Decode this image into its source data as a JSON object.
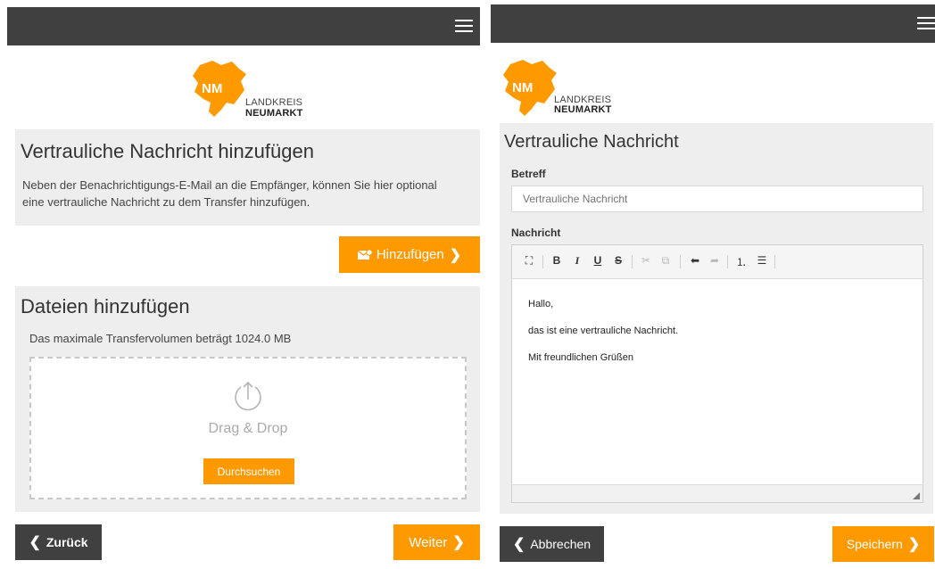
{
  "left": {
    "logo": {
      "abbr": "NM",
      "line1": "LANDKREIS",
      "line2": "NEUMARKT"
    },
    "message_section": {
      "title": "Vertrauliche Nachricht hinzufügen",
      "description_line1": "Neben der Benachrichtigungs-E-Mail an die Empfänger, können Sie hier optional",
      "description_line2": "eine vertrauliche Nachricht zu dem Transfer hinzufügen.",
      "add_button": "Hinzufügen"
    },
    "files_section": {
      "title": "Dateien hinzufügen",
      "limit_text": "Das maximale Transfervolumen beträgt 1024.0 MB",
      "drop_label": "Drag & Drop",
      "browse_button": "Durchsuchen"
    },
    "back_button": "Zurück",
    "next_button": "Weiter"
  },
  "right": {
    "logo": {
      "abbr": "NM",
      "line1": "LANDKREIS",
      "line2": "NEUMARKT"
    },
    "title": "Vertrauliche Nachricht",
    "subject_label": "Betreff",
    "subject_placeholder": "Vertrauliche Nachricht",
    "message_label": "Nachricht",
    "toolbar": [
      "maximize-icon",
      "bold-icon",
      "italic-icon",
      "underline-icon",
      "strikethrough-icon",
      "cut-icon",
      "copy-icon",
      "undo-icon",
      "redo-icon",
      "numbered-list-icon",
      "bullet-list-icon"
    ],
    "message_lines": [
      "Hallo,",
      "das ist eine vertrauliche Nachricht.",
      "Mit freundlichen Grüßen"
    ],
    "cancel_button": "Abbrechen",
    "save_button": "Speichern"
  },
  "colors": {
    "accent": "#ff9900",
    "dark": "#404040",
    "panel_bg": "#eeeeee"
  }
}
